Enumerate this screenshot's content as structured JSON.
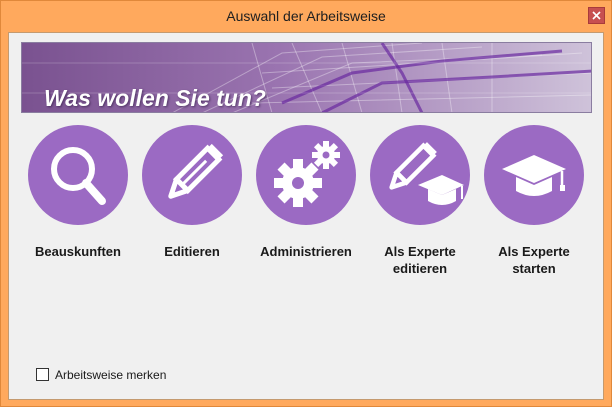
{
  "window": {
    "title": "Auswahl der Arbeitsweise",
    "close_icon": "close-icon"
  },
  "banner": {
    "text": "Was wollen Sie tun?"
  },
  "actions": [
    {
      "label": "Beauskunften",
      "label2": "",
      "icon": "search-icon"
    },
    {
      "label": "Editieren",
      "label2": "",
      "icon": "pencil-icon"
    },
    {
      "label": "Administrieren",
      "label2": "",
      "icon": "gears-icon"
    },
    {
      "label": "Als Experte",
      "label2": "editieren",
      "icon": "pencil-graduation-cap-icon"
    },
    {
      "label": "Als Experte",
      "label2": "starten",
      "icon": "graduation-cap-icon"
    }
  ],
  "remember": {
    "label": "Arbeitsweise merken",
    "checked": false
  },
  "colors": {
    "accent": "#9b6ac3",
    "frame": "#ffa95d",
    "close": "#c75050"
  }
}
